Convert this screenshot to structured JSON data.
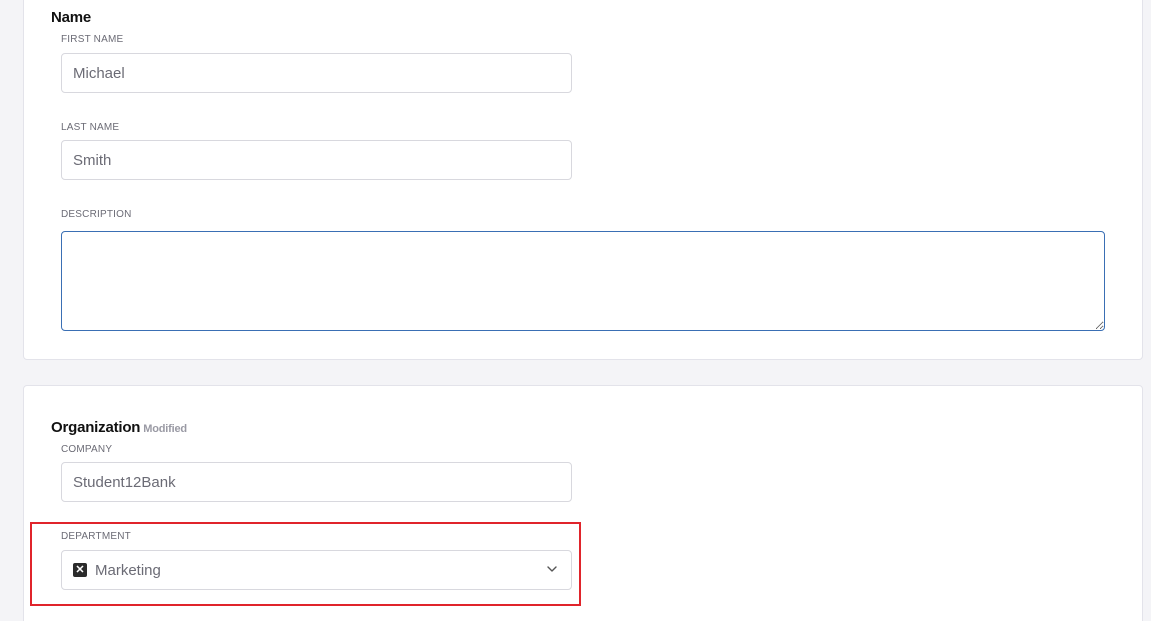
{
  "name_section": {
    "title": "Name",
    "first_name": {
      "label": "FIRST NAME",
      "value": "Michael"
    },
    "last_name": {
      "label": "LAST NAME",
      "value": "Smith"
    },
    "description": {
      "label": "DESCRIPTION",
      "value": ""
    }
  },
  "organization_section": {
    "title": "Organization",
    "badge": "Modified",
    "company": {
      "label": "COMPANY",
      "value": "Student12Bank"
    },
    "department": {
      "label": "DEPARTMENT",
      "value": "Marketing",
      "remove_icon": "close-icon",
      "dropdown_icon": "chevron-down-icon"
    }
  },
  "colors": {
    "highlight": "#e0242b",
    "focus_border": "#3a6fb4"
  }
}
